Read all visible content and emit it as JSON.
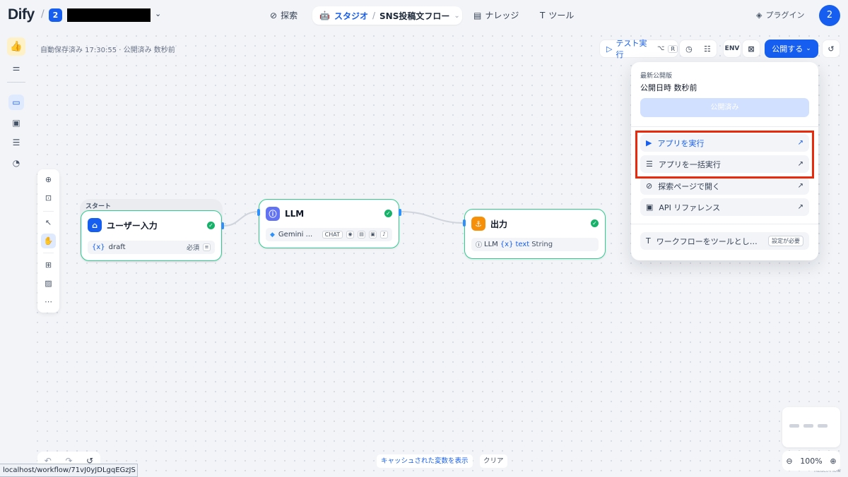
{
  "header": {
    "logo": "Dify",
    "workspace_badge": "2",
    "nav_explore": "探索",
    "nav_studio": "スタジオ",
    "current_app": "SNS投稿文フロー",
    "nav_knowledge": "ナレッジ",
    "nav_tools": "ツール",
    "plugins": "プラグイン",
    "avatar": "2"
  },
  "app_icon": "👍",
  "status": {
    "autosave": "自動保存済み 17:30:55 · 公開済み 数秒前"
  },
  "toolbar": {
    "test_run": "テスト実行",
    "shortcut_mod": "⌥",
    "shortcut_key": "R",
    "env_label": "ENV",
    "publish": "公開する"
  },
  "publish_menu": {
    "latest_version": "最新公開版",
    "published_time": "公開日時 数秒前",
    "published_button": "公開済み",
    "run_app": "アプリを実行",
    "batch_run": "アプリを一括実行",
    "open_explore": "探索ページで開く",
    "api_reference": "API リファレンス",
    "workflow_as_tool": "ワークフローをツールとし…",
    "needs_config": "設定が必要"
  },
  "nodes": {
    "start_label": "スタート",
    "start": {
      "title": "ユーザー入力",
      "var_icon": "{x}",
      "var": "draft",
      "required": "必須"
    },
    "llm": {
      "title": "LLM",
      "model": "Gemini ...",
      "mode": "CHAT"
    },
    "output": {
      "title": "出力",
      "source": "LLM",
      "var_icon": "{x}",
      "var": "text",
      "type": "String"
    }
  },
  "bottom": {
    "url": "localhost/workflow/71vJ0yJDLgqEGzJS",
    "cached_vars": "キャッシュされた変数を表示",
    "clear": "クリア",
    "zoom": "100%",
    "attribution": "React Flow"
  },
  "colors": {
    "primary": "#155eef",
    "node_border": "#2ecc8f",
    "success": "#17b26a",
    "highlight": "#e8290b"
  }
}
